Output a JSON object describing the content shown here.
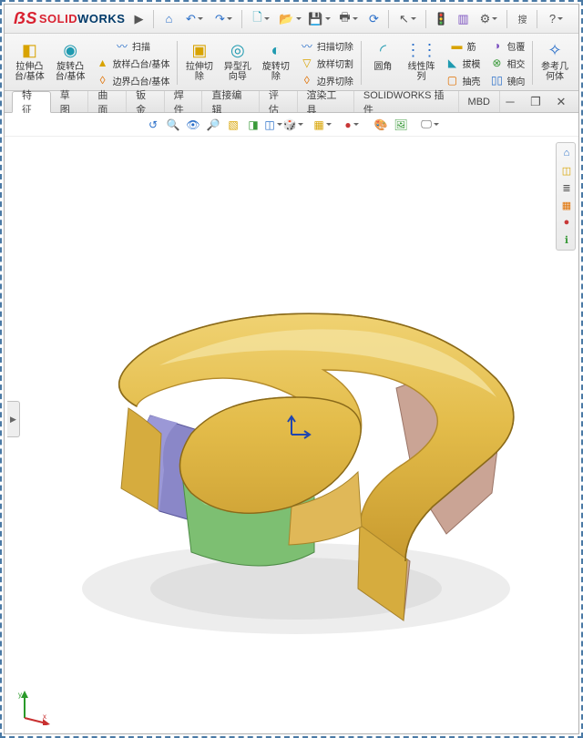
{
  "app": {
    "name_solid": "SOLID",
    "name_works": "WORKS"
  },
  "qat": {
    "home": "⌂",
    "undo": "↶",
    "redo": "↷",
    "new": "🗋",
    "open": "📂",
    "save": "💾",
    "print": "🖶",
    "refresh": "⟳",
    "cursor": "↖",
    "rebuild": "🚦",
    "options": "⚙",
    "search_label": "搜",
    "help": "?"
  },
  "win": {
    "min": "─",
    "max": "☐",
    "close": "✕"
  },
  "ribbon": {
    "extrude": "拉伸凸\n台/基体",
    "revolve": "旋转凸\n台/基体",
    "sweep": "扫描",
    "loft": "放样凸台/基体",
    "boundary": "边界凸台/基体",
    "cut_extrude": "拉伸切\n除",
    "hole": "异型孔\n向导",
    "cut_revolve": "旋转切\n除",
    "cut_sweep": "扫描切除",
    "cut_loft": "放样切割",
    "cut_boundary": "边界切除",
    "fillet": "圆角",
    "pattern": "线性阵\n列",
    "rib": "筋",
    "draft": "拔模",
    "shell": "抽壳",
    "wrap": "包覆",
    "intersect": "相交",
    "mirror": "镜向",
    "refgeom": "参考几\n何体"
  },
  "tabs": {
    "t0": "特征",
    "t1": "草图",
    "t2": "曲面",
    "t3": "钣金",
    "t4": "焊件",
    "t5": "直接编辑",
    "t6": "评估",
    "t7": "渲染工具",
    "t8": "SOLIDWORKS 插件",
    "t9": "MBD"
  },
  "viewtb": {
    "orbit": "↺",
    "zoom": "🔍",
    "pan": "⊕",
    "section": "▧",
    "display": "◫",
    "views": "🎲",
    "wireframe": "▦",
    "scene": "●",
    "appearance": "🎨",
    "decal": "🖼",
    "screen": "🖵"
  },
  "side": {
    "home": "⌂",
    "iso": "◫",
    "layers": "≣",
    "paint": "▦",
    "color": "●",
    "info": "ℹ"
  },
  "flyout": "▶",
  "triad": {
    "x": "x",
    "y": "y"
  }
}
